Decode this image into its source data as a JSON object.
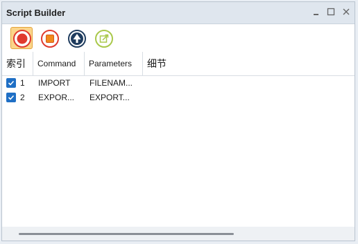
{
  "window": {
    "title": "Script Builder",
    "controls": [
      "minimize",
      "maximize",
      "close"
    ]
  },
  "toolbar": {
    "buttons": [
      {
        "name": "record",
        "icon": "record-icon",
        "active": true
      },
      {
        "name": "stop",
        "icon": "stop-icon",
        "active": false
      },
      {
        "name": "run",
        "icon": "play-up-icon",
        "active": false
      },
      {
        "name": "export",
        "icon": "export-icon",
        "active": false
      }
    ]
  },
  "table": {
    "headers": {
      "index": "索引",
      "command": "Command",
      "parameters": "Parameters",
      "details": "细节"
    },
    "rows": [
      {
        "checked": true,
        "index": "1",
        "command": "IMPORT",
        "parameters": "FILENAM...",
        "details": ""
      },
      {
        "checked": true,
        "index": "2",
        "command": "EXPOR...",
        "parameters": "EXPORT...",
        "details": ""
      }
    ]
  },
  "colors": {
    "accent": "#1f6fc5",
    "record": "#e03a2f",
    "active_button": "#fbd58a",
    "run_button": "#1f3c5e",
    "export_button": "#a9c84a"
  }
}
